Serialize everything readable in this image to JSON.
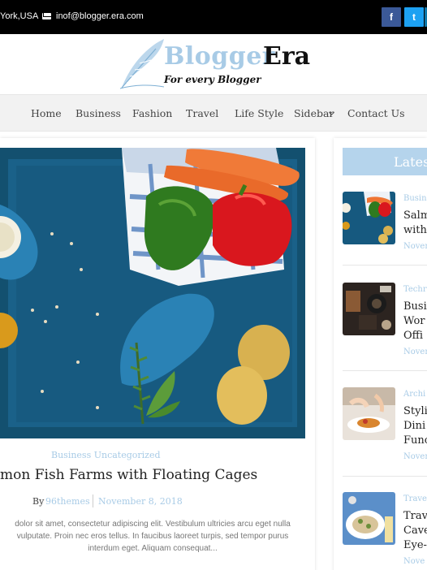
{
  "topbar": {
    "location": "York,USA",
    "email": "inof@blogger.era.com",
    "social": {
      "facebook": "f",
      "twitter": "t"
    }
  },
  "logo": {
    "name_part1": "Blogger",
    "name_part2": "Era",
    "tagline": "For every Blogger"
  },
  "nav": {
    "items": [
      "Home",
      "Business",
      "Fashion",
      "Travel",
      "Life Style",
      "Sidebar",
      "Contact Us"
    ]
  },
  "article": {
    "categories": "Business Uncategorized",
    "title": "mon Fish Farms with Floating Cages",
    "by": "By",
    "author": "96themes",
    "date": "November 8, 2018",
    "excerpt": [
      "dolor sit amet, consectetur adipiscing elit. Vestibulum ultricies arcu eget nulla",
      "vulputate. Proin nec eros tellus. In faucibus laoreet turpis, sed tempor purus",
      "interdum eget. Aliquam consequat..."
    ]
  },
  "sidebar": {
    "title": "Lates",
    "posts": [
      {
        "category": "Busin",
        "title_lines": [
          "Salm",
          "with"
        ],
        "date": "Nover"
      },
      {
        "category": "Techr",
        "title_lines": [
          "Busi",
          "Wor",
          "Offi"
        ],
        "date": "Nover"
      },
      {
        "category": "Archi",
        "title_lines": [
          "Styli",
          "Dini",
          "Func"
        ],
        "date": "Nover"
      },
      {
        "category": "Trave",
        "title_lines": [
          "Trav",
          "Cave",
          "Eye-"
        ],
        "date": "Nove"
      }
    ]
  },
  "colors": {
    "accent": "#a8cbe6",
    "topbar_bg": "#000000",
    "nav_bg": "#f2f2f2",
    "facebook": "#3b5998",
    "twitter": "#1da1f2"
  }
}
